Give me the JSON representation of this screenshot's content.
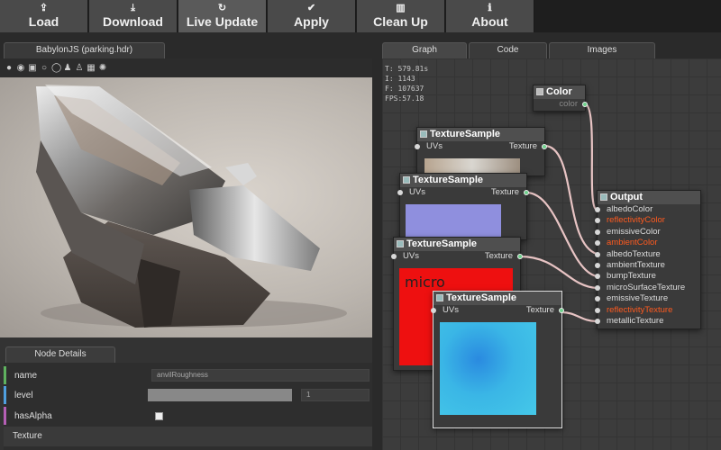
{
  "toolbar": {
    "buttons": [
      {
        "label": "Load",
        "icon": "upload-icon"
      },
      {
        "label": "Download",
        "icon": "download-icon"
      },
      {
        "label": "Live Update",
        "icon": "refresh-icon"
      },
      {
        "label": "Apply",
        "icon": "check-circle-icon"
      },
      {
        "label": "Clean Up",
        "icon": "trash-icon"
      },
      {
        "label": "About",
        "icon": "info-icon"
      }
    ]
  },
  "preview": {
    "tab_label": "BabylonJS (parking.hdr)",
    "toolbar_icons": [
      "sphere-icon",
      "sphere-shaded-icon",
      "cube-icon",
      "circle-icon",
      "ring-icon",
      "figure-icon",
      "figure-alt-icon",
      "grid-icon",
      "spinner-icon"
    ]
  },
  "node_details": {
    "tab_label": "Node Details",
    "rows": [
      {
        "label": "name",
        "value": "anvilRoughness",
        "color": "#5fb25f"
      },
      {
        "label": "level",
        "value": "1",
        "color": "#4f9fdf"
      },
      {
        "label": "hasAlpha",
        "value": "",
        "color": "#b55fb5"
      }
    ],
    "section_label": "Texture"
  },
  "graph_tabs": [
    {
      "label": "Graph"
    },
    {
      "label": "Code"
    },
    {
      "label": "Images"
    }
  ],
  "stats": {
    "t": "T: 579.81s",
    "i": "I: 1143",
    "f": "F: 107637",
    "fps": "FPS:57.18"
  },
  "nodes": {
    "color": {
      "title": "Color",
      "output": "color"
    },
    "texture_sample": {
      "title": "TextureSample",
      "input": "UVs",
      "output": "Texture"
    },
    "micro_label": "micro",
    "output": {
      "title": "Output",
      "ports": [
        {
          "label": "albedoColor",
          "highlight": false
        },
        {
          "label": "reflectivityColor",
          "highlight": true
        },
        {
          "label": "emissiveColor",
          "highlight": false
        },
        {
          "label": "ambientColor",
          "highlight": true
        },
        {
          "label": "albedoTexture",
          "highlight": false
        },
        {
          "label": "ambientTexture",
          "highlight": false
        },
        {
          "label": "bumpTexture",
          "highlight": false
        },
        {
          "label": "microSurfaceTexture",
          "highlight": false
        },
        {
          "label": "emissiveTexture",
          "highlight": false
        },
        {
          "label": "reflectivityTexture",
          "highlight": true
        },
        {
          "label": "metallicTexture",
          "highlight": false
        }
      ]
    }
  },
  "colors": {
    "highlight_port": "#ff5a1f",
    "wire": "#e8c4c4",
    "port_connected": "#6fd08c"
  }
}
